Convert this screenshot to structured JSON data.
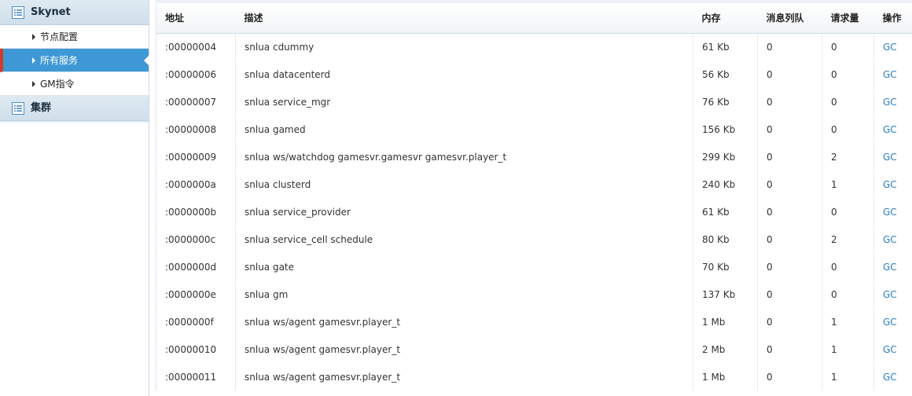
{
  "sidebar": {
    "groups": [
      {
        "label": "Skynet",
        "items": [
          {
            "label": "节点配置"
          },
          {
            "label": "所有服务"
          },
          {
            "label": "GM指令"
          }
        ]
      },
      {
        "label": "集群",
        "items": []
      }
    ],
    "active_item": "所有服务",
    "colors": {
      "active_bg": "#3f98d6",
      "active_marker": "#d23b2a",
      "header_bg": "#d6e4ee"
    }
  },
  "table": {
    "headers": {
      "address": "地址",
      "description": "描述",
      "memory": "内存",
      "message_queue": "消息列队",
      "requests": "请求量",
      "action": "操作"
    },
    "rows": [
      {
        "address": ":00000004",
        "description": "snlua cdummy",
        "memory": "61 Kb",
        "mq": "0",
        "requests": "0",
        "action": "GC"
      },
      {
        "address": ":00000006",
        "description": "snlua datacenterd",
        "memory": "56 Kb",
        "mq": "0",
        "requests": "0",
        "action": "GC"
      },
      {
        "address": ":00000007",
        "description": "snlua service_mgr",
        "memory": "76 Kb",
        "mq": "0",
        "requests": "0",
        "action": "GC"
      },
      {
        "address": ":00000008",
        "description": "snlua gamed",
        "memory": "156 Kb",
        "mq": "0",
        "requests": "0",
        "action": "GC"
      },
      {
        "address": ":00000009",
        "description": "snlua ws/watchdog gamesvr.gamesvr gamesvr.player_t",
        "memory": "299 Kb",
        "mq": "0",
        "requests": "2",
        "action": "GC"
      },
      {
        "address": ":0000000a",
        "description": "snlua clusterd",
        "memory": "240 Kb",
        "mq": "0",
        "requests": "1",
        "action": "GC"
      },
      {
        "address": ":0000000b",
        "description": "snlua service_provider",
        "memory": "61 Kb",
        "mq": "0",
        "requests": "0",
        "action": "GC"
      },
      {
        "address": ":0000000c",
        "description": "snlua service_cell schedule",
        "memory": "80 Kb",
        "mq": "0",
        "requests": "2",
        "action": "GC"
      },
      {
        "address": ":0000000d",
        "description": "snlua gate",
        "memory": "70 Kb",
        "mq": "0",
        "requests": "0",
        "action": "GC"
      },
      {
        "address": ":0000000e",
        "description": "snlua gm",
        "memory": "137 Kb",
        "mq": "0",
        "requests": "0",
        "action": "GC"
      },
      {
        "address": ":0000000f",
        "description": "snlua ws/agent gamesvr.player_t",
        "memory": "1 Mb",
        "mq": "0",
        "requests": "1",
        "action": "GC"
      },
      {
        "address": ":00000010",
        "description": "snlua ws/agent gamesvr.player_t",
        "memory": "2 Mb",
        "mq": "0",
        "requests": "1",
        "action": "GC"
      },
      {
        "address": ":00000011",
        "description": "snlua ws/agent gamesvr.player_t",
        "memory": "1 Mb",
        "mq": "0",
        "requests": "1",
        "action": "GC"
      }
    ],
    "link_color": "#2a7ec2"
  },
  "icons": {
    "group_icon": "list-icon",
    "item_arrow": "caret-right-icon"
  }
}
